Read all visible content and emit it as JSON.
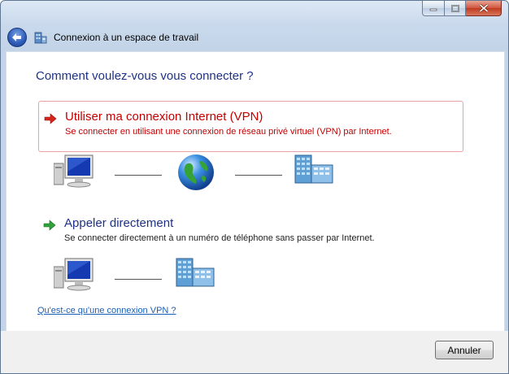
{
  "window": {
    "title": "Connexion à un espace de travail",
    "controls": {
      "minimize_icon": "minimize-icon",
      "maximize_icon": "maximize-icon",
      "close_icon": "close-icon"
    }
  },
  "nav": {
    "back_icon": "back-arrow-icon",
    "app_icon": "workplace-network-icon"
  },
  "main": {
    "heading": "Comment voulez-vous vous connecter ?",
    "options": [
      {
        "title": "Utiliser ma connexion Internet (VPN)",
        "description": "Se connecter en utilisant une connexion de réseau privé virtuel (VPN) par Internet.",
        "icon": "red-arrow-icon",
        "color": "#c40000",
        "illustration": [
          "computer-icon",
          "globe-icon",
          "server-building-icon"
        ]
      },
      {
        "title": "Appeler directement",
        "description": "Se connecter directement à un numéro de téléphone sans passer par Internet.",
        "icon": "green-arrow-icon",
        "color": "#1e3287",
        "illustration": [
          "computer-icon",
          "server-building-icon"
        ]
      }
    ],
    "help_link": "Qu'est-ce qu'une connexion VPN ?"
  },
  "footer": {
    "cancel_label": "Annuler"
  },
  "colors": {
    "heading": "#1e3287",
    "link": "#1a5fb4",
    "vpn_border": "#e9a3a3"
  }
}
